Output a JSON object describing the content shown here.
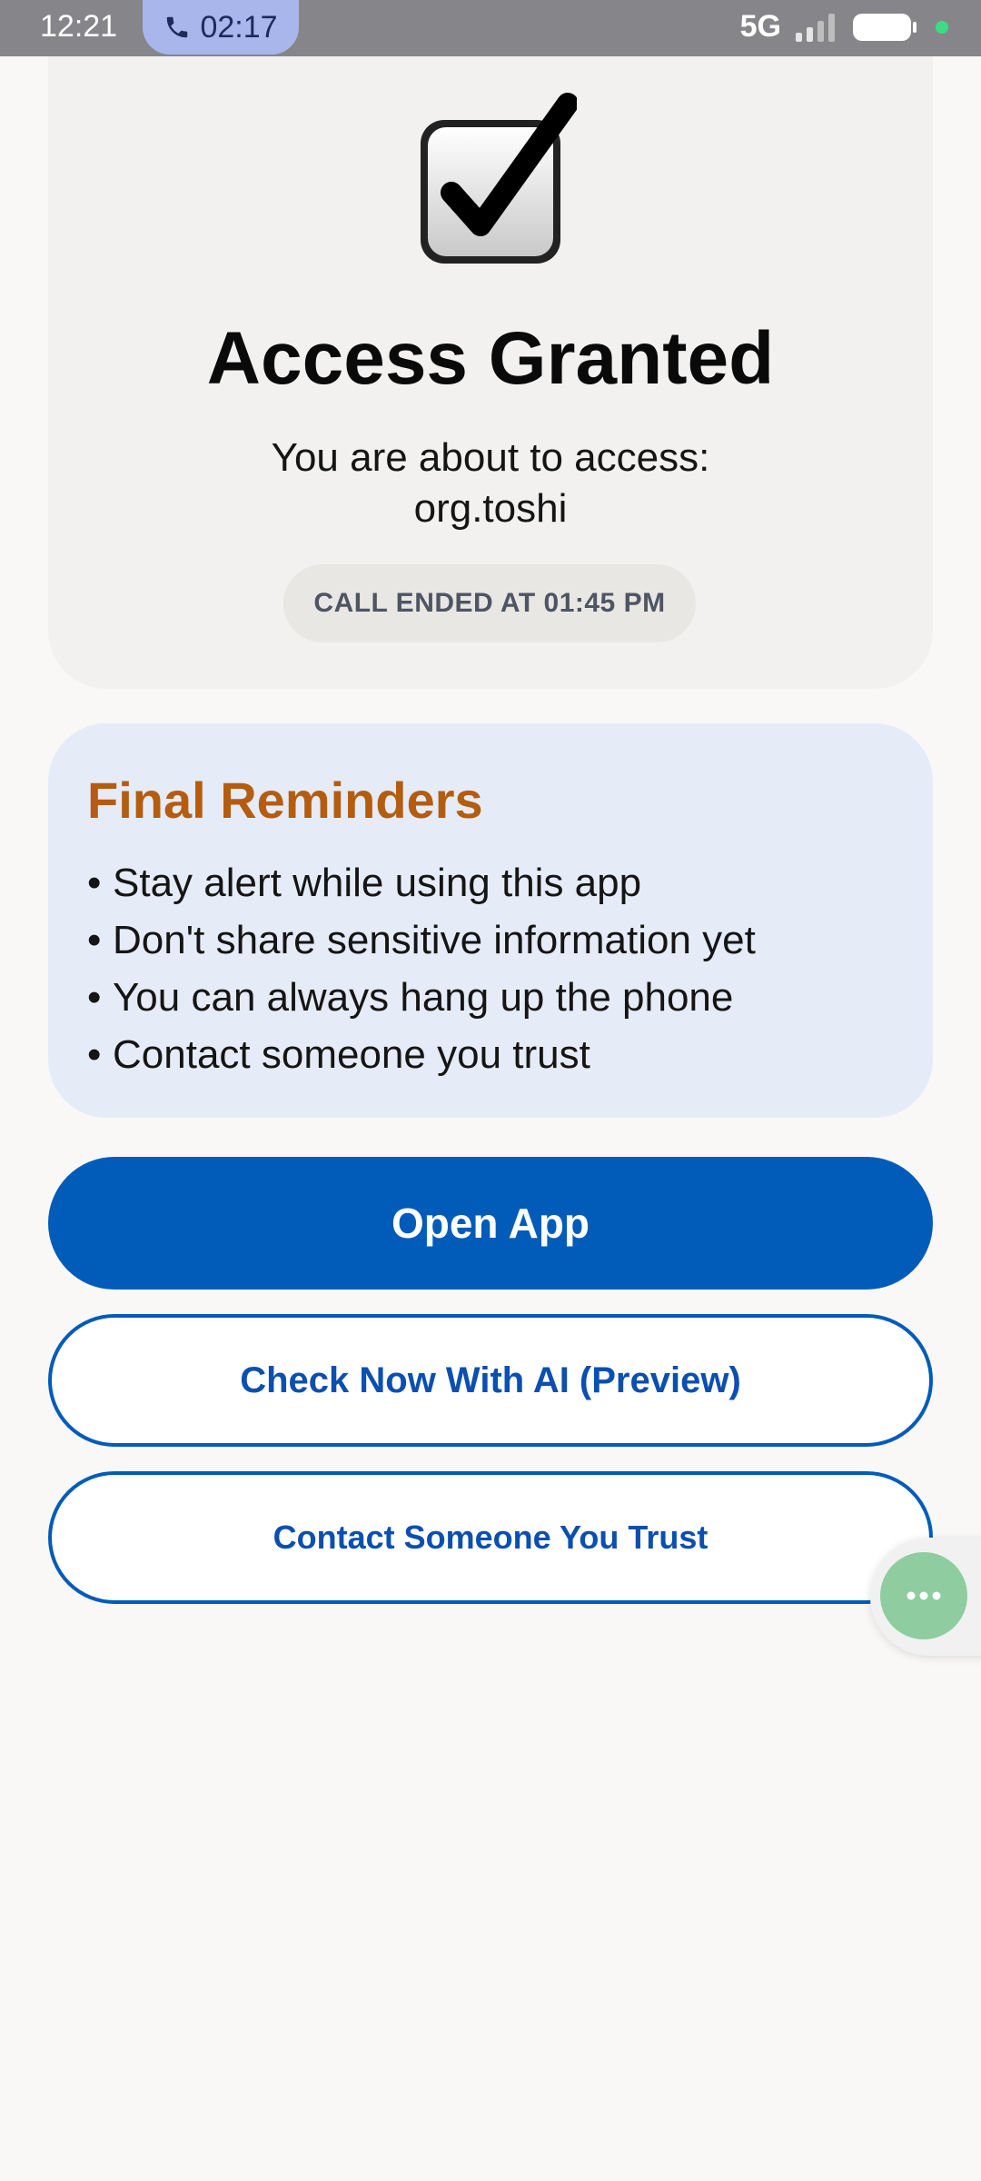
{
  "status_bar": {
    "time": "12:21",
    "call_timer": "02:17",
    "network": "5G",
    "call_icon": "phone-icon",
    "signal_icon": "signal-bars-icon",
    "battery_icon": "battery-icon"
  },
  "access": {
    "icon": "check-box-icon",
    "title": "Access Granted",
    "subtitle_line1": "You are about to access:",
    "subtitle_line2": "org.toshi",
    "call_ended": "CALL ENDED AT 01:45 PM"
  },
  "reminders": {
    "title": "Final Reminders",
    "items": [
      "Stay alert while using this app",
      "Don't share sensitive information yet",
      "You can always hang up the phone",
      "Contact someone you trust"
    ]
  },
  "buttons": {
    "open_app": "Open App",
    "check_ai": "Check Now With AI (Preview)",
    "contact_trust": "Contact Someone You Trust"
  },
  "floating": {
    "icon": "more-dots-icon"
  },
  "colors": {
    "primary": "#005bb9",
    "reminder_title": "#b45d10",
    "reminder_bg": "#e6ecf7",
    "fab": "#8fcca0"
  }
}
